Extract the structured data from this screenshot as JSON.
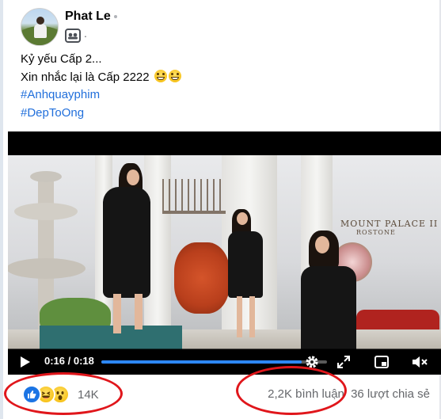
{
  "post": {
    "author_name": "Phat Le",
    "audience_icon": "group-icon",
    "lines": [
      "Kỷ yếu Cấp 2...",
      "Xin nhắc lại là Cấp 2222"
    ],
    "hashtags": [
      "#Anhquayphim",
      "#DepToOng"
    ]
  },
  "video": {
    "time_display": "0:16 / 0:18",
    "progress": 0.889,
    "sign_text": "MOUNT PALACE II",
    "sign_subtext": "ROSTONE",
    "controls": [
      "play-icon",
      "settings-icon",
      "fullscreen-icon",
      "miniplayer-icon",
      "volume-icon"
    ]
  },
  "engagement": {
    "reaction_icons": [
      "like-icon",
      "haha-icon",
      "wow-icon"
    ],
    "reaction_count": "14K",
    "comments": "2,2K bình luận",
    "shares": "36 lượt chia sẻ"
  },
  "colors": {
    "hashtag": "#216fdb",
    "annotation": "#e0161b",
    "progress": "#2d88ff",
    "like": "#1b74e4"
  }
}
